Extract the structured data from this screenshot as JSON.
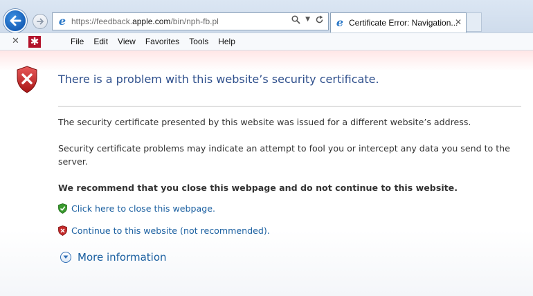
{
  "browser": {
    "address": {
      "url_prefix": "https://feedback.",
      "url_host": "apple.com",
      "url_path": "/bin/nph-fb.pl",
      "search_icon": "magnifier-icon",
      "refresh_icon": "refresh-icon"
    },
    "tab": {
      "title": "Certificate Error: Navigation...",
      "close": "✕"
    },
    "menu": {
      "close_glyph": "✕",
      "addon_glyph": "✱",
      "items": [
        "File",
        "Edit",
        "View",
        "Favorites",
        "Tools",
        "Help"
      ]
    }
  },
  "page": {
    "title": "There is a problem with this website’s security certificate.",
    "paragraph1": "The security certificate presented by this website was issued for a different website’s address.",
    "paragraph2": "Security certificate problems may indicate an attempt to fool you or intercept any data you send to the server.",
    "recommendation": "We recommend that you close this webpage and do not continue to this website.",
    "close_link": "Click here to close this webpage.",
    "continue_link": "Continue to this website (not recommended).",
    "more_info": "More information"
  },
  "colors": {
    "title": "#2e4f8c",
    "link": "#1a5fa0",
    "shield_red": "#c42a2a",
    "shield_green": "#3a9a2e"
  }
}
